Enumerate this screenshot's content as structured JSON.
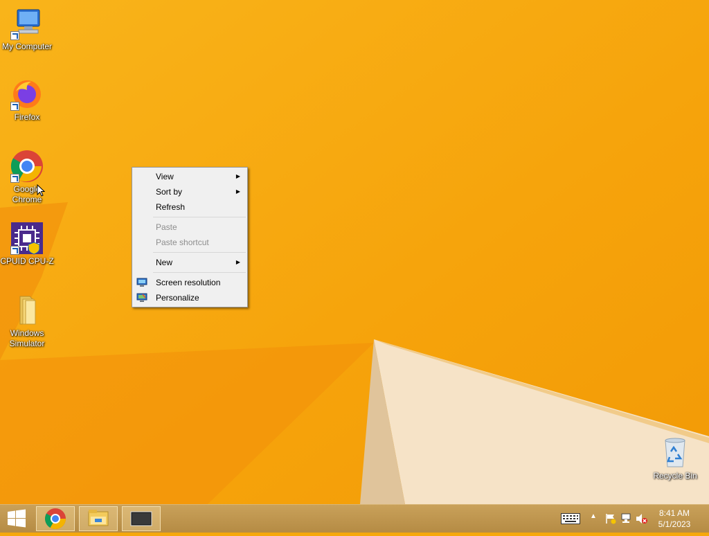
{
  "desktop": {
    "icons": [
      {
        "label": "My Computer",
        "icon": "computer-icon"
      },
      {
        "label": "Firefox",
        "icon": "firefox-icon"
      },
      {
        "label": "Google Chrome",
        "icon": "chrome-icon"
      },
      {
        "label": "CPUID CPU-Z",
        "icon": "cpuz-icon"
      },
      {
        "label": "Windows Simulator",
        "icon": "folder-icon"
      },
      {
        "label": "Recycle Bin",
        "icon": "recycle-bin-icon"
      }
    ]
  },
  "context_menu": {
    "items": [
      {
        "label": "View",
        "has_submenu": true,
        "enabled": true
      },
      {
        "label": "Sort by",
        "has_submenu": true,
        "enabled": true
      },
      {
        "label": "Refresh",
        "has_submenu": false,
        "enabled": true
      },
      {
        "label": "Paste",
        "has_submenu": false,
        "enabled": false
      },
      {
        "label": "Paste shortcut",
        "has_submenu": false,
        "enabled": false
      },
      {
        "label": "New",
        "has_submenu": true,
        "enabled": true
      },
      {
        "label": "Screen resolution",
        "has_submenu": false,
        "enabled": true,
        "icon": "display-settings-icon"
      },
      {
        "label": "Personalize",
        "has_submenu": false,
        "enabled": true,
        "icon": "personalize-icon"
      }
    ]
  },
  "taskbar": {
    "pinned": [
      "chrome-icon",
      "file-explorer-icon",
      "monitor-window-icon"
    ],
    "tray_icons": [
      "keyboard-icon",
      "show-hidden-icons-icon",
      "action-center-flag-icon",
      "network-icon",
      "volume-muted-icon"
    ],
    "clock": {
      "time": "8:41 AM",
      "date": "5/1/2023"
    }
  },
  "colors": {
    "wallpaper": "#f6a80c",
    "taskbar": "#c09850",
    "menu_bg": "#f0f0f0"
  }
}
